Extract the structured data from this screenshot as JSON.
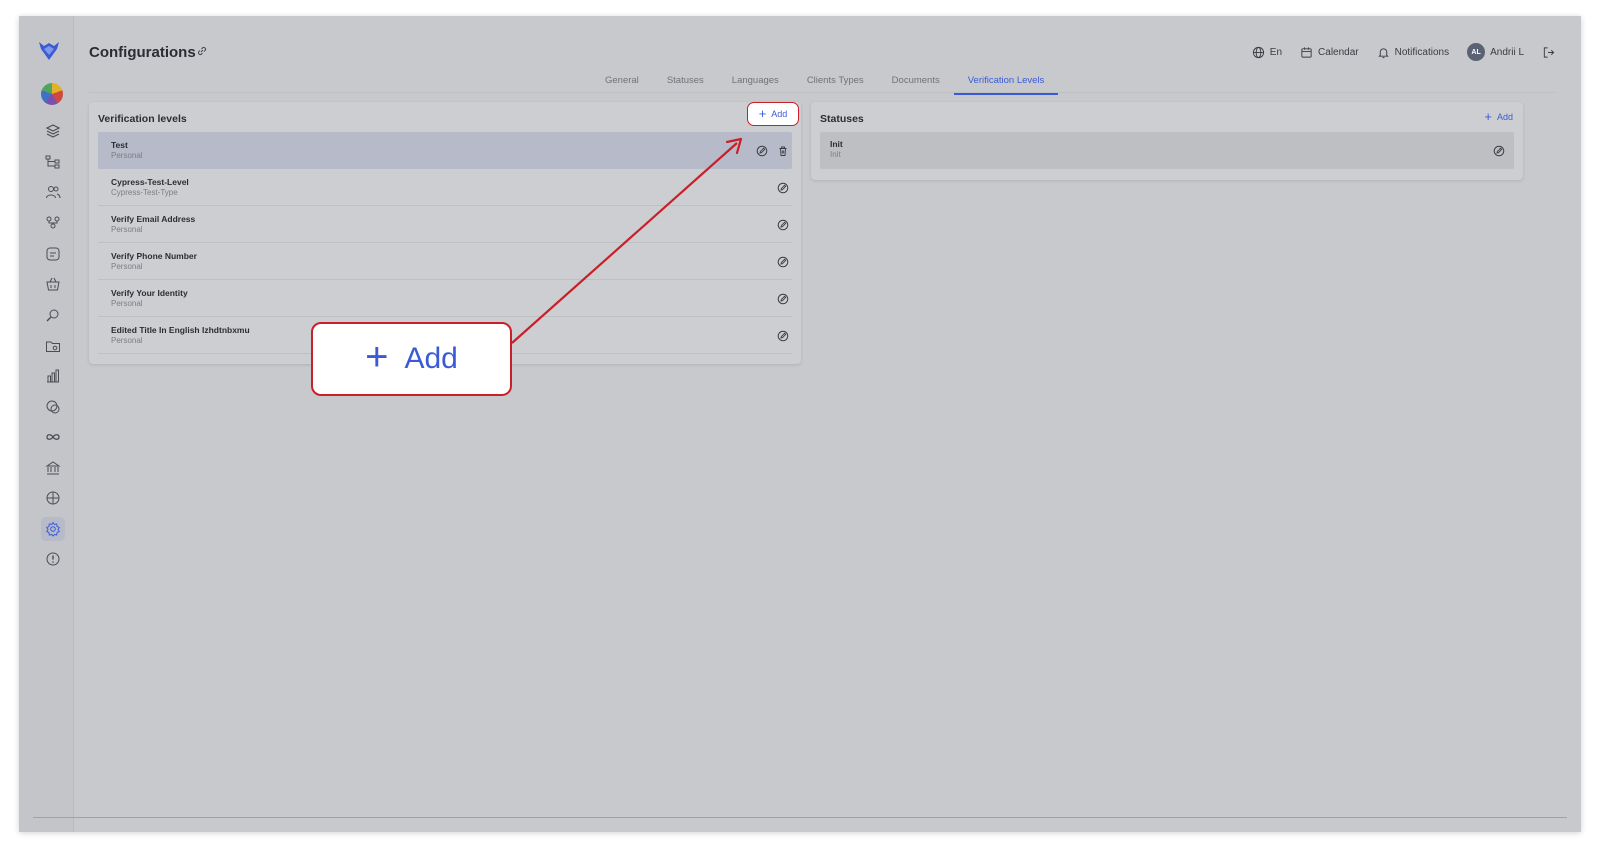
{
  "header": {
    "title": "Configurations",
    "language": "En",
    "calendar": "Calendar",
    "notifications": "Notifications",
    "avatar_initials": "AL",
    "user_name": "Andrii L"
  },
  "tabs": [
    {
      "label": "General"
    },
    {
      "label": "Statuses"
    },
    {
      "label": "Languages"
    },
    {
      "label": "Clients Types"
    },
    {
      "label": "Documents"
    },
    {
      "label": "Verification Levels",
      "active": true
    }
  ],
  "verification_levels": {
    "title": "Verification levels",
    "add_label": "Add",
    "items": [
      {
        "name": "Test",
        "type": "Personal"
      },
      {
        "name": "Cypress-Test-Level",
        "type": "Cypress-Test-Type"
      },
      {
        "name": "Verify Email Address",
        "type": "Personal"
      },
      {
        "name": "Verify Phone Number",
        "type": "Personal"
      },
      {
        "name": "Verify Your Identity",
        "type": "Personal"
      },
      {
        "name": "Edited Title In English Izhdtnbxmu",
        "type": "Personal"
      }
    ]
  },
  "statuses": {
    "title": "Statuses",
    "add_label": "Add",
    "items": [
      {
        "name": "Init",
        "code": "Init"
      }
    ]
  },
  "callout": {
    "label": "Add"
  },
  "sidebar_icons": [
    "stack-icon",
    "hierarchy-icon",
    "users-icon",
    "team-icon",
    "sticker-icon",
    "basket-icon",
    "search-doc-icon",
    "folder-icon",
    "chart-icon",
    "coins-icon",
    "infinity-icon",
    "bank-icon",
    "box-icon",
    "settings-icon",
    "shield-icon"
  ],
  "colors": {
    "accent": "#3b5bd6",
    "highlight": "#c8202a",
    "background": "#c8c9cc"
  }
}
